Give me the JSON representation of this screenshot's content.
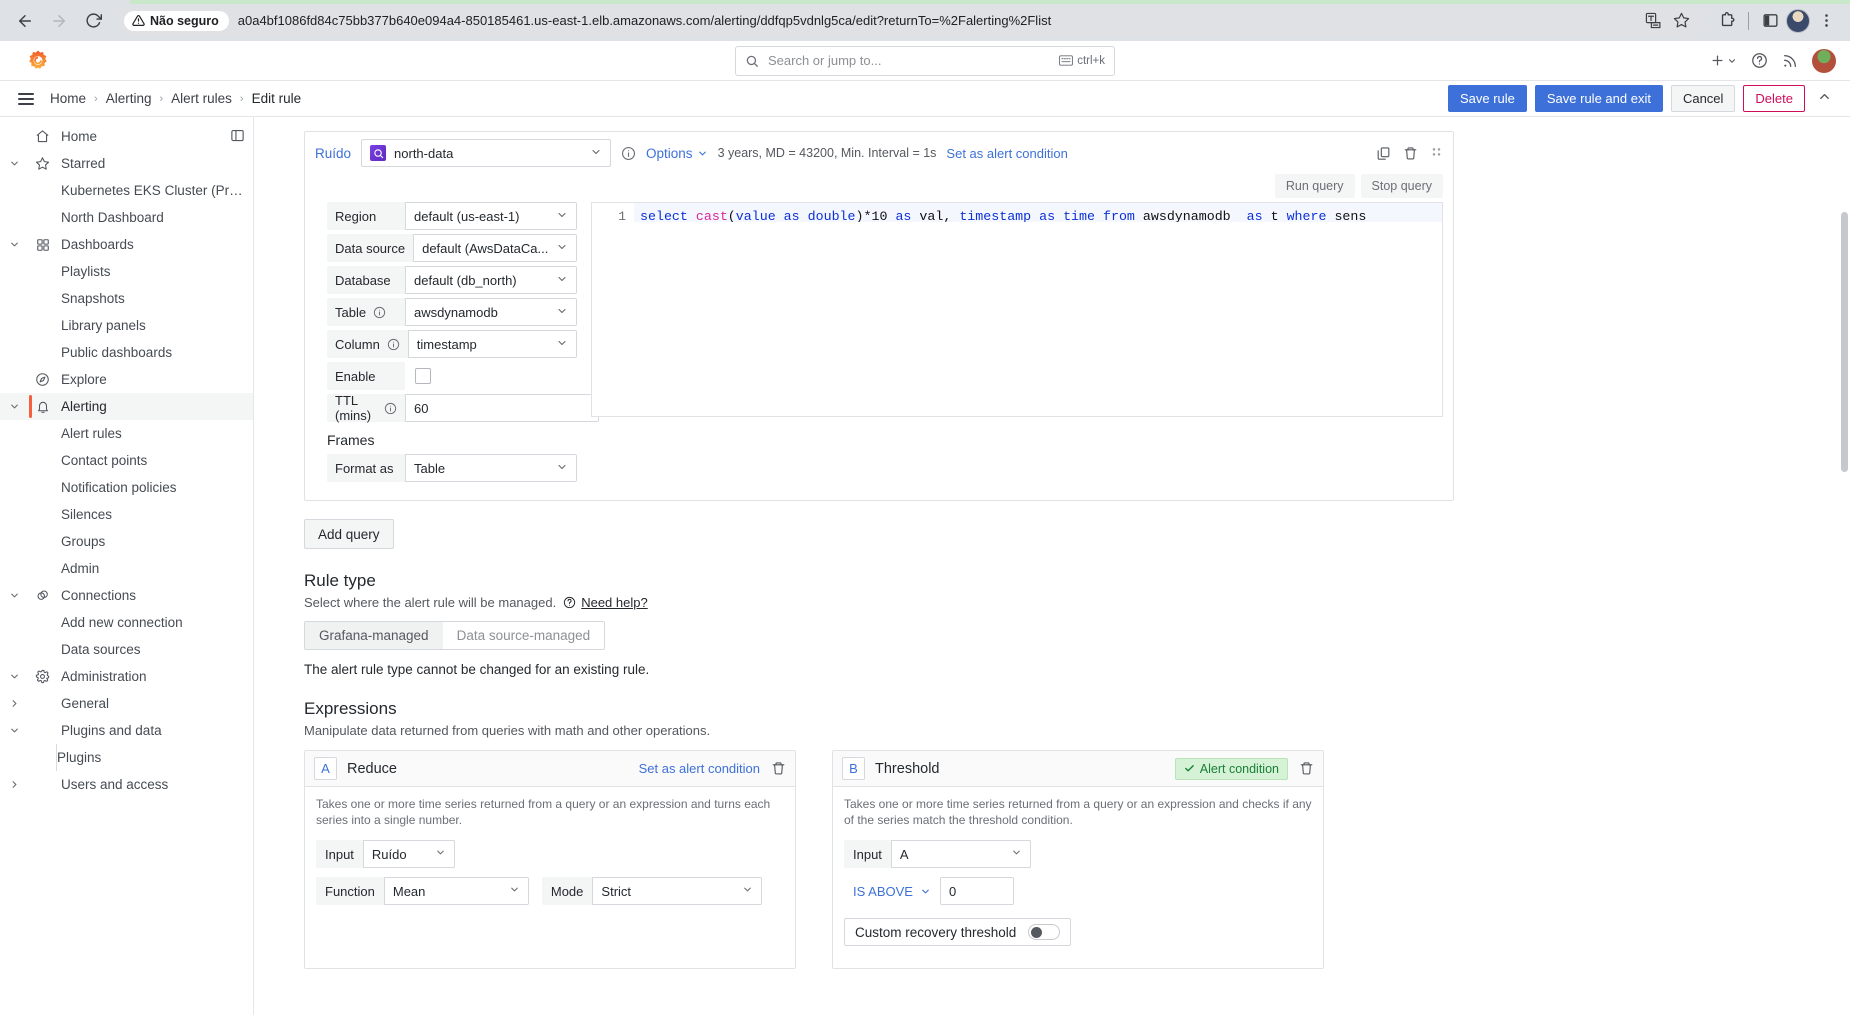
{
  "browser": {
    "back_icon": "back-arrow-icon",
    "forward_icon": "forward-arrow-icon",
    "reload_icon": "reload-icon",
    "security_label": "Não seguro",
    "url": "a0a4bf1086fd84c75bb377b640e094a4-850185461.us-east-1.elb.amazonaws.com/alerting/ddfqp5vdnlg5ca/edit?returnTo=%2Falerting%2Flist",
    "translate_icon": "translate-icon",
    "bookmark_icon": "star-icon",
    "extensions_icon": "puzzle-piece-icon",
    "sidepanel_icon": "side-panel-icon",
    "profile_icon": "profile-avatar",
    "menu_icon": "three-dot-menu-icon"
  },
  "topbar": {
    "logo": "grafana-logo",
    "search_placeholder": "Search or jump to...",
    "search_value": "",
    "kbd_hint": "ctrl+k",
    "add_icon": "plus-icon",
    "help_icon": "question-circle-icon",
    "news_icon": "rss-news-icon",
    "profile": "user-avatar"
  },
  "breadcrumb": {
    "menu_icon": "hamburger-menu-icon",
    "items": [
      {
        "label": "Home"
      },
      {
        "label": "Alerting"
      },
      {
        "label": "Alert rules"
      },
      {
        "label": "Edit rule"
      }
    ],
    "separator": "›",
    "actions": {
      "save": "Save rule",
      "save_exit": "Save rule and exit",
      "cancel": "Cancel",
      "delete": "Delete",
      "collapse_icon": "chevron-up-icon"
    }
  },
  "sidebar": {
    "dock_icon": "dock-menu-icon",
    "items": [
      {
        "label": "Home",
        "icon": "home-icon",
        "level": 0,
        "caret": "",
        "active": false,
        "dock": true
      },
      {
        "label": "Starred",
        "icon": "star-icon",
        "level": 0,
        "caret": "down",
        "active": false
      },
      {
        "label": "Kubernetes EKS Cluster (Pro...",
        "icon": "",
        "level": 1,
        "caret": "",
        "active": false
      },
      {
        "label": "North Dashboard",
        "icon": "",
        "level": 1,
        "caret": "",
        "active": false
      },
      {
        "label": "Dashboards",
        "icon": "dashboards-grid-icon",
        "level": 0,
        "caret": "down",
        "active": false
      },
      {
        "label": "Playlists",
        "icon": "",
        "level": 1,
        "caret": "",
        "active": false
      },
      {
        "label": "Snapshots",
        "icon": "",
        "level": 1,
        "caret": "",
        "active": false
      },
      {
        "label": "Library panels",
        "icon": "",
        "level": 1,
        "caret": "",
        "active": false
      },
      {
        "label": "Public dashboards",
        "icon": "",
        "level": 1,
        "caret": "",
        "active": false
      },
      {
        "label": "Explore",
        "icon": "compass-icon",
        "level": 0,
        "caret": "",
        "active": false
      },
      {
        "label": "Alerting",
        "icon": "bell-icon",
        "level": 0,
        "caret": "down",
        "active": true
      },
      {
        "label": "Alert rules",
        "icon": "",
        "level": 1,
        "caret": "",
        "active": false
      },
      {
        "label": "Contact points",
        "icon": "",
        "level": 1,
        "caret": "",
        "active": false
      },
      {
        "label": "Notification policies",
        "icon": "",
        "level": 1,
        "caret": "",
        "active": false
      },
      {
        "label": "Silences",
        "icon": "",
        "level": 1,
        "caret": "",
        "active": false
      },
      {
        "label": "Groups",
        "icon": "",
        "level": 1,
        "caret": "",
        "active": false
      },
      {
        "label": "Admin",
        "icon": "",
        "level": 1,
        "caret": "",
        "active": false
      },
      {
        "label": "Connections",
        "icon": "connections-icon",
        "level": 0,
        "caret": "down",
        "active": false
      },
      {
        "label": "Add new connection",
        "icon": "",
        "level": 1,
        "caret": "",
        "active": false
      },
      {
        "label": "Data sources",
        "icon": "",
        "level": 1,
        "caret": "",
        "active": false
      },
      {
        "label": "Administration",
        "icon": "gear-icon",
        "level": 0,
        "caret": "down",
        "active": false
      },
      {
        "label": "General",
        "icon": "",
        "level": 1,
        "caret": "right",
        "active": false
      },
      {
        "label": "Plugins and data",
        "icon": "",
        "level": 1,
        "caret": "down",
        "active": false
      },
      {
        "label": "Plugins",
        "icon": "",
        "level": 2,
        "caret": "",
        "active": false
      },
      {
        "label": "Users and access",
        "icon": "",
        "level": 1,
        "caret": "right",
        "active": false
      }
    ]
  },
  "query": {
    "ref_id": "Ruído",
    "datasource": "north-data",
    "datasource_logo": "aws-datasource-icon",
    "info_icon": "info-circle-icon",
    "options_label": "Options",
    "options_meta": "3 years, MD = 43200, Min. Interval = 1s",
    "set_alert_condition": "Set as alert condition",
    "copy_icon": "copy-icon",
    "delete_icon": "trash-icon",
    "drag_icon": "drag-handle-icon",
    "run_query": "Run query",
    "stop_query": "Stop query",
    "fields": [
      {
        "label": "Region",
        "value": "default (us-east-1)",
        "type": "select",
        "info": false
      },
      {
        "label": "Data source",
        "value": "default (AwsDataCa...",
        "type": "select",
        "info": false
      },
      {
        "label": "Database",
        "value": "default (db_north)",
        "type": "select",
        "info": false
      },
      {
        "label": "Table",
        "value": "awsdynamodb",
        "type": "select",
        "info": true
      },
      {
        "label": "Column",
        "value": "timestamp",
        "type": "select",
        "info": true
      },
      {
        "label": "Enable",
        "value": "",
        "type": "checkbox",
        "info": false
      },
      {
        "label": "TTL (mins)",
        "value": "60",
        "type": "input",
        "info": true
      }
    ],
    "frames_header": "Frames",
    "format_as_label": "Format as",
    "format_as_value": "Table",
    "sql_line_number": "1",
    "sql": "select cast(value as double)*10 as val, timestamp as time from awsdynamodb  as t where sens",
    "add_query": "Add query"
  },
  "rule_type": {
    "heading": "Rule type",
    "subtitle": "Select where the alert rule will be managed.",
    "help_link": "Need help?",
    "help_icon": "question-circle-icon",
    "options": [
      "Grafana-managed",
      "Data source-managed"
    ],
    "selected": "Grafana-managed",
    "note": "The alert rule type cannot be changed for an existing rule."
  },
  "expressions": {
    "heading": "Expressions",
    "subtitle": "Manipulate data returned from queries with math and other operations.",
    "cards": [
      {
        "ref": "A",
        "title": "Reduce",
        "action_link": "Set as alert condition",
        "delete_icon": "trash-icon",
        "description": "Takes one or more time series returned from a query or an expression and turns each series into a single number.",
        "input_label": "Input",
        "input_value": "Ruído",
        "function_label": "Function",
        "function_value": "Mean",
        "mode_label": "Mode",
        "mode_value": "Strict"
      },
      {
        "ref": "B",
        "title": "Threshold",
        "badge": "Alert condition",
        "badge_icon": "check-icon",
        "delete_icon": "trash-icon",
        "description": "Takes one or more time series returned from a query or an expression and checks if any of the series match the threshold condition.",
        "input_label": "Input",
        "input_value": "A",
        "operator": "IS ABOVE",
        "threshold_value": "0",
        "recovery_label": "Custom recovery threshold",
        "recovery_on": false
      }
    ]
  },
  "colors": {
    "accent_blue": "#3d71d9",
    "danger_pink": "#cf0e5b",
    "alert_orange": "#f55f3e",
    "success_green": "#1a7f37"
  }
}
